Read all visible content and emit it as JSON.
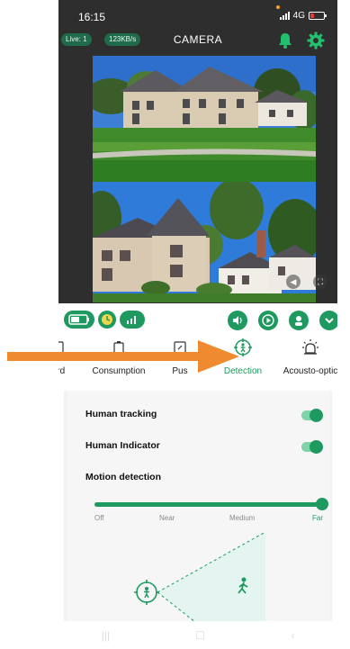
{
  "status_bar": {
    "time": "16:15",
    "network": "4G"
  },
  "header": {
    "live_badge": "Live: 1",
    "speed_badge": "123KB/s",
    "title": "CAMERA",
    "bell_icon": "bell-icon",
    "settings_icon": "gear-icon"
  },
  "tabs": [
    {
      "label": "ard",
      "icon": "card-icon"
    },
    {
      "label": "Consumption",
      "icon": "battery-icon"
    },
    {
      "label": "Pus",
      "icon": "push-icon"
    },
    {
      "label": "Detection",
      "icon": "detection-icon",
      "active": true
    },
    {
      "label": "Acousto-optic",
      "icon": "light-icon"
    }
  ],
  "settings": {
    "human_tracking": {
      "label": "Human tracking",
      "enabled": true
    },
    "human_indicator": {
      "label": "Human Indicator",
      "enabled": true
    },
    "motion_detection": {
      "label": "Motion detection",
      "levels": [
        "Off",
        "Near",
        "Medium",
        "Far"
      ],
      "selected": "Far"
    }
  },
  "colors": {
    "accent": "#1e9a61",
    "annotation_arrow": "#f08a2e",
    "background_dark": "#2e2e2e"
  }
}
